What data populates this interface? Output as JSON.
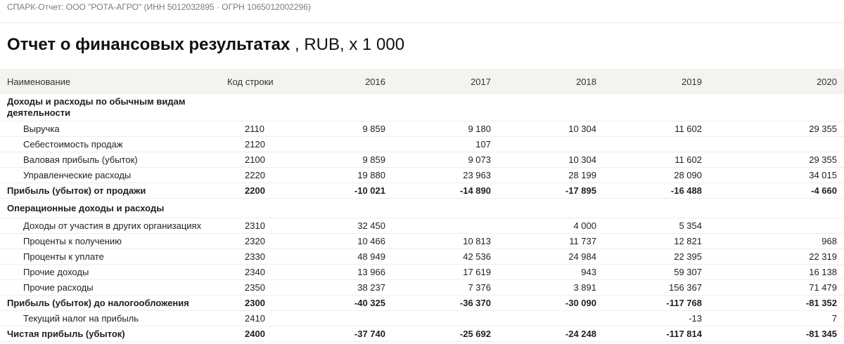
{
  "header": {
    "source_line": "СПАРК-Отчет: ООО \"РОТА-АГРО\" (ИНН 5012032895 · ОГРН 1065012002296)"
  },
  "title": {
    "main": "Отчет о финансовых результатах",
    "units": " , RUB, x 1 000"
  },
  "table": {
    "columns": [
      "Наименование",
      "Код строки",
      "2016",
      "2017",
      "2018",
      "2019",
      "2020"
    ],
    "rows": [
      {
        "kind": "section",
        "name": "Доходы и расходы по обычным видам деятельности",
        "code": "",
        "values": [
          "",
          "",
          "",
          "",
          ""
        ]
      },
      {
        "kind": "indent",
        "name": "Выручка",
        "code": "2110",
        "values": [
          "9 859",
          "9 180",
          "10 304",
          "11 602",
          "29 355"
        ]
      },
      {
        "kind": "indent",
        "name": "Себестоимость продаж",
        "code": "2120",
        "values": [
          "",
          "107",
          "",
          "",
          ""
        ]
      },
      {
        "kind": "indent",
        "name": "Валовая прибыль (убыток)",
        "code": "2100",
        "values": [
          "9 859",
          "9 073",
          "10 304",
          "11 602",
          "29 355"
        ]
      },
      {
        "kind": "indent",
        "name": "Управленческие расходы",
        "code": "2220",
        "values": [
          "19 880",
          "23 963",
          "28 199",
          "28 090",
          "34 015"
        ]
      },
      {
        "kind": "total",
        "name": "Прибыль (убыток) от продажи",
        "code": "2200",
        "values": [
          "-10 021",
          "-14 890",
          "-17 895",
          "-16 488",
          "-4 660"
        ]
      },
      {
        "kind": "section",
        "name": "Операционные доходы и расходы",
        "code": "",
        "values": [
          "",
          "",
          "",
          "",
          ""
        ]
      },
      {
        "kind": "indent",
        "name": "Доходы от участия в других организациях",
        "code": "2310",
        "values": [
          "32 450",
          "",
          "4 000",
          "5 354",
          ""
        ]
      },
      {
        "kind": "indent",
        "name": "Проценты к получению",
        "code": "2320",
        "values": [
          "10 466",
          "10 813",
          "11 737",
          "12 821",
          "968"
        ]
      },
      {
        "kind": "indent",
        "name": "Проценты к уплате",
        "code": "2330",
        "values": [
          "48 949",
          "42 536",
          "24 984",
          "22 395",
          "22 319"
        ]
      },
      {
        "kind": "indent",
        "name": "Прочие доходы",
        "code": "2340",
        "values": [
          "13 966",
          "17 619",
          "943",
          "59 307",
          "16 138"
        ]
      },
      {
        "kind": "indent",
        "name": "Прочие расходы",
        "code": "2350",
        "values": [
          "38 237",
          "7 376",
          "3 891",
          "156 367",
          "71 479"
        ]
      },
      {
        "kind": "total",
        "name": "Прибыль (убыток) до налогообложения",
        "code": "2300",
        "values": [
          "-40 325",
          "-36 370",
          "-30 090",
          "-117 768",
          "-81 352"
        ]
      },
      {
        "kind": "indent",
        "name": "Текущий налог на прибыль",
        "code": "2410",
        "values": [
          "",
          "",
          "",
          "-13",
          "7"
        ]
      },
      {
        "kind": "total",
        "name": "Чистая прибыль (убыток)",
        "code": "2400",
        "values": [
          "-37 740",
          "-25 692",
          "-24 248",
          "-117 814",
          "-81 345"
        ]
      }
    ]
  }
}
